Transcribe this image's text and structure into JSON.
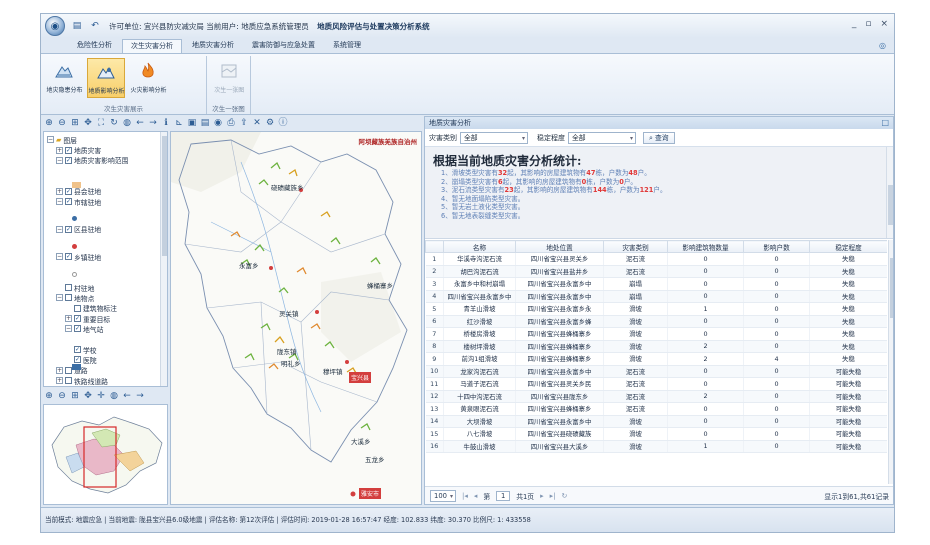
{
  "titlebar": {
    "text": "许可单位: 宜兴县防灾减灾局  当前用户: 地质应急系统管理员",
    "app_name": "地质风险评估与处置决策分析系统",
    "win_controls": [
      "_",
      "▫",
      "×"
    ]
  },
  "menu": [
    "危险性分析",
    "次生灾害分析",
    "地质灾害分析",
    "震害防御与应急处置",
    "系统管理"
  ],
  "menu_active_index": 1,
  "ribbon": {
    "groups": [
      {
        "label": "次生灾害展示",
        "buttons": [
          "地灾隐患分布",
          "地质影响分析",
          "火灾影响分析"
        ]
      },
      {
        "label": "次生一张图",
        "buttons": [
          "次生一张图"
        ]
      }
    ],
    "active_button": "地质影响分析"
  },
  "layers": [
    {
      "label": "图层",
      "level": 0,
      "expander": "−",
      "checked": null,
      "icon": "folder-icon"
    },
    {
      "label": "地质灾害",
      "level": 1,
      "expander": "+",
      "checked": true
    },
    {
      "label": "地质灾害影响范围",
      "level": 1,
      "expander": "−",
      "checked": true
    },
    {
      "label": "县会驻地",
      "level": 1,
      "expander": "+",
      "checked": true
    },
    {
      "label": "市辖驻地",
      "level": 1,
      "expander": "−",
      "checked": true
    },
    {
      "label": "区县驻地",
      "level": 1,
      "expander": "−",
      "checked": true
    },
    {
      "label": "乡镇驻地",
      "level": 1,
      "expander": "−",
      "checked": true
    },
    {
      "label": "村驻地",
      "level": 1,
      "expander": null,
      "checked": false
    },
    {
      "label": "地物点",
      "level": 1,
      "expander": "−",
      "checked": false
    },
    {
      "label": "建筑物标注",
      "level": 2,
      "expander": null,
      "checked": false
    },
    {
      "label": "重要目标",
      "level": 2,
      "expander": "+",
      "checked": true
    },
    {
      "label": "地气站",
      "level": 2,
      "expander": "−",
      "checked": true
    },
    {
      "label": "学校",
      "level": 2,
      "expander": null,
      "checked": true
    },
    {
      "label": "医院",
      "level": 2,
      "expander": null,
      "checked": true
    },
    {
      "label": "道路",
      "level": 1,
      "expander": "+",
      "checked": false
    },
    {
      "label": "铁路线道路",
      "level": 1,
      "expander": "+",
      "checked": false
    }
  ],
  "map": {
    "county_label": "阿坝藏族羌族自治州",
    "places": [
      "硗碛藏族乡",
      "永富乡",
      "灵关镇",
      "宝兴县",
      "陇东镇",
      "蜂桶寨乡",
      "明礼乡",
      "穆坪镇",
      "大溪乡",
      "五龙乡"
    ],
    "town_tag": "宝兴县",
    "bottom_tag": "雅安市"
  },
  "panel": {
    "title": "地质灾害分析",
    "close": "□",
    "filter": {
      "type_label": "灾害类别",
      "type_value": "全部",
      "level_label": "稳定程度",
      "level_value": "全部",
      "query_button": "查询"
    },
    "summary": {
      "title": "根据当前地质灾害分析统计:",
      "lines": [
        {
          "pre": "1、滑坡类型灾害有",
          "n1": "32",
          "mid": "起，其影响的房屋建筑物有",
          "n2": "47",
          "mid2": "栋，户数为",
          "n3": "48",
          "post": "户。"
        },
        {
          "pre": "2、崩塌类型灾害有",
          "n1": "6",
          "mid": "起，其影响的房屋建筑物有",
          "n2": "0",
          "mid2": "栋，户数为",
          "n3": "0",
          "post": "户。"
        },
        {
          "pre": "3、泥石流类型灾害有",
          "n1": "23",
          "mid": "起，其影响的房屋建筑物有",
          "n2": "144",
          "mid2": "栋，户数为",
          "n3": "121",
          "post": "户。"
        },
        {
          "pre": "4、暂无地面塌陷类型灾害。"
        },
        {
          "pre": "5、暂无岩土液化类型灾害。"
        },
        {
          "pre": "6、暂无地表裂缝类型灾害。"
        }
      ]
    },
    "table": {
      "columns": [
        "",
        "名称",
        "地处位置",
        "灾害类别",
        "影响建筑物数量",
        "影响户数",
        "稳定程度"
      ],
      "rows": [
        [
          "1",
          "华溪寺沟泥石流",
          "四川省宝兴县灵关乡",
          "泥石流",
          "0",
          "0",
          "失稳"
        ],
        [
          "2",
          "胡巴沟泥石流",
          "四川省宝兴县盐井乡",
          "泥石流",
          "0",
          "0",
          "失稳"
        ],
        [
          "3",
          "永富乡中和村崩塌",
          "四川省宝兴县永富乡中",
          "崩塌",
          "0",
          "0",
          "失稳"
        ],
        [
          "4",
          "四川省宝兴县永富乡中",
          "四川省宝兴县永富乡中",
          "崩塌",
          "0",
          "0",
          "失稳"
        ],
        [
          "5",
          "青羊山滑坡",
          "四川省宝兴县永富乡永",
          "滑坡",
          "1",
          "0",
          "失稳"
        ],
        [
          "6",
          "红沙滑坡",
          "四川省宝兴县永富乡蜂",
          "滑坡",
          "0",
          "0",
          "失稳"
        ],
        [
          "7",
          "桥楼房滑坡",
          "四川省宝兴县蜂桶寨乡",
          "滑坡",
          "0",
          "0",
          "失稳"
        ],
        [
          "8",
          "楼树坪滑坡",
          "四川省宝兴县蜂桶寨乡",
          "滑坡",
          "2",
          "0",
          "失稳"
        ],
        [
          "9",
          "前沟1组滑坡",
          "四川省宝兴县蜂桶寨乡",
          "滑坡",
          "2",
          "4",
          "失稳"
        ],
        [
          "10",
          "龙家沟泥石流",
          "四川省宝兴县永富乡中",
          "泥石流",
          "0",
          "0",
          "可能失稳"
        ],
        [
          "11",
          "马道子泥石流",
          "四川省宝兴县灵关乡民",
          "泥石流",
          "0",
          "0",
          "可能失稳"
        ],
        [
          "12",
          "十四中沟泥石流",
          "四川省宝兴县陇东乡",
          "泥石流",
          "2",
          "0",
          "可能失稳"
        ],
        [
          "13",
          "黄泉眼泥石流",
          "四川省宝兴县蜂桶寨乡",
          "泥石流",
          "0",
          "0",
          "可能失稳"
        ],
        [
          "14",
          "大坝滑坡",
          "四川省宝兴县永富乡中",
          "滑坡",
          "0",
          "0",
          "可能失稳"
        ],
        [
          "15",
          "八七滑坡",
          "四川省宝兴县硗碛藏族",
          "滑坡",
          "0",
          "0",
          "可能失稳"
        ],
        [
          "16",
          "牛鼓山滑坡",
          "四川省宝兴县大溪乡",
          "滑坡",
          "1",
          "0",
          "可能失稳"
        ]
      ]
    },
    "pager": {
      "page_size": "100",
      "page_prefix": "第",
      "page": "1",
      "total_pages": "共1页",
      "info": "显示1到61,共61记录"
    }
  },
  "statusbar": {
    "text": "当前模式: 地震应急 | 当前地震: 陇县宝兴县6.0级地震 | 评估名称: 第12次评估 | 评估时间: 2019-01-28 16:57:47   经度: 102.833  纬度: 30.370  比例尺: 1: 433558"
  },
  "colors": {
    "accent": "#3b6ea5",
    "highlight_number": "#e03838",
    "ribbon_active": "#f8cf6a",
    "map_boundary": "#7a8fb0",
    "county_fill": "#e08a8a"
  }
}
